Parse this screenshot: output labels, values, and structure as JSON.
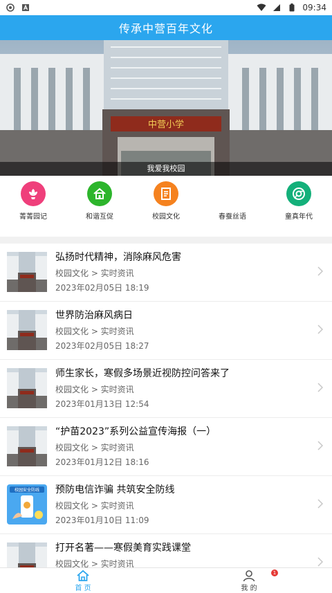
{
  "status_bar": {
    "time": "09:34"
  },
  "header": {
    "title": "传承中营百年文化"
  },
  "banner": {
    "caption": "我爱我校园",
    "sign": "中营小学"
  },
  "quick_nav": [
    {
      "label": "菁菁园记",
      "icon": "flower-icon",
      "color": "#ef3f7b"
    },
    {
      "label": "和谐互促",
      "icon": "home-icon",
      "color": "#2db52c"
    },
    {
      "label": "校园文化",
      "icon": "document-icon",
      "color": "#f5821f"
    },
    {
      "label": "春蚕丝语",
      "icon": "",
      "color": ""
    },
    {
      "label": "童真年代",
      "icon": "chrome-circle-icon",
      "color": "#14b07a"
    }
  ],
  "news": [
    {
      "title": "弘扬时代精神，消除麻风危害",
      "category": "校园文化 > 实时资讯",
      "date": "2023年02月05日 18:19"
    },
    {
      "title": "世界防治麻风病日",
      "category": "校园文化 > 实时资讯",
      "date": "2023年02月05日 18:27"
    },
    {
      "title": "师生家长，寒假多场景近视防控问答来了",
      "category": "校园文化 > 实时资讯",
      "date": "2023年01月13日 12:54"
    },
    {
      "title": "“护苗2023”系列公益宣传海报（一）",
      "category": "校园文化 > 实时资讯",
      "date": "2023年01月12日 18:16"
    },
    {
      "title": "预防电信诈骗 共筑安全防线",
      "category": "校园文化 > 实时资讯",
      "date": "2023年01月10日 11:09",
      "thumb_text": "校园安全防线"
    },
    {
      "title": "打开名著——寒假美育实践课堂",
      "category": "校园文化 > 实时资讯",
      "date": ""
    }
  ],
  "tabs": {
    "home": "首 页",
    "me": "我 的",
    "badge": "1"
  }
}
